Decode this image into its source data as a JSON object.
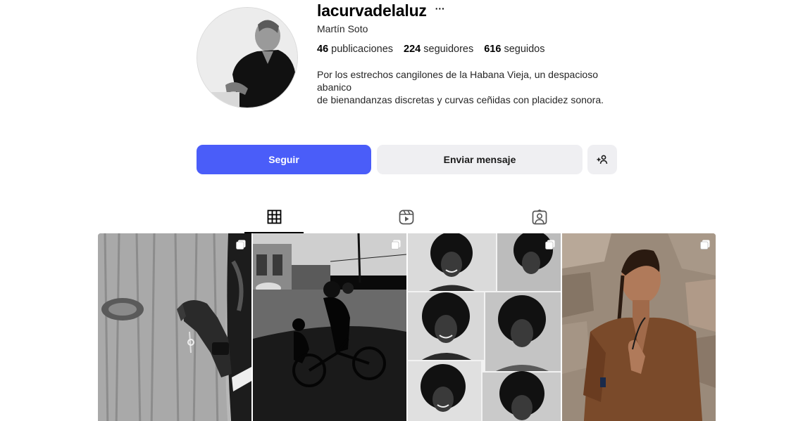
{
  "profile": {
    "username": "lacurvadelaluz",
    "more_icon": "more-horizontal-icon",
    "full_name": "Martín Soto",
    "stats": [
      {
        "value": "46",
        "label": " publicaciones"
      },
      {
        "value": "224",
        "label": " seguidores"
      },
      {
        "value": "616",
        "label": " seguidos"
      }
    ],
    "bio_line1": "Por los estrechos cangilones de la Habana Vieja, un despacioso abanico",
    "bio_line2": "de bienandanzas discretas y curvas ceñidas con placidez sonora."
  },
  "actions": {
    "follow_label": "Seguir",
    "message_label": "Enviar mensaje",
    "suggest_icon": "add-person-icon",
    "follow_color": "#4a5df9",
    "secondary_bg": "#efeff2"
  },
  "tabs": [
    {
      "icon": "grid-icon",
      "active": true
    },
    {
      "icon": "reels-icon",
      "active": false
    },
    {
      "icon": "tagged-icon",
      "active": false
    }
  ],
  "posts": [
    {
      "subject": "hand on tree trunk",
      "icon": "carousel-icon"
    },
    {
      "subject": "street silhouette cyclist",
      "icon": "carousel-icon"
    },
    {
      "subject": "portrait collage",
      "icon": "carousel-icon"
    },
    {
      "subject": "man in brown shirt",
      "icon": "carousel-icon"
    }
  ]
}
